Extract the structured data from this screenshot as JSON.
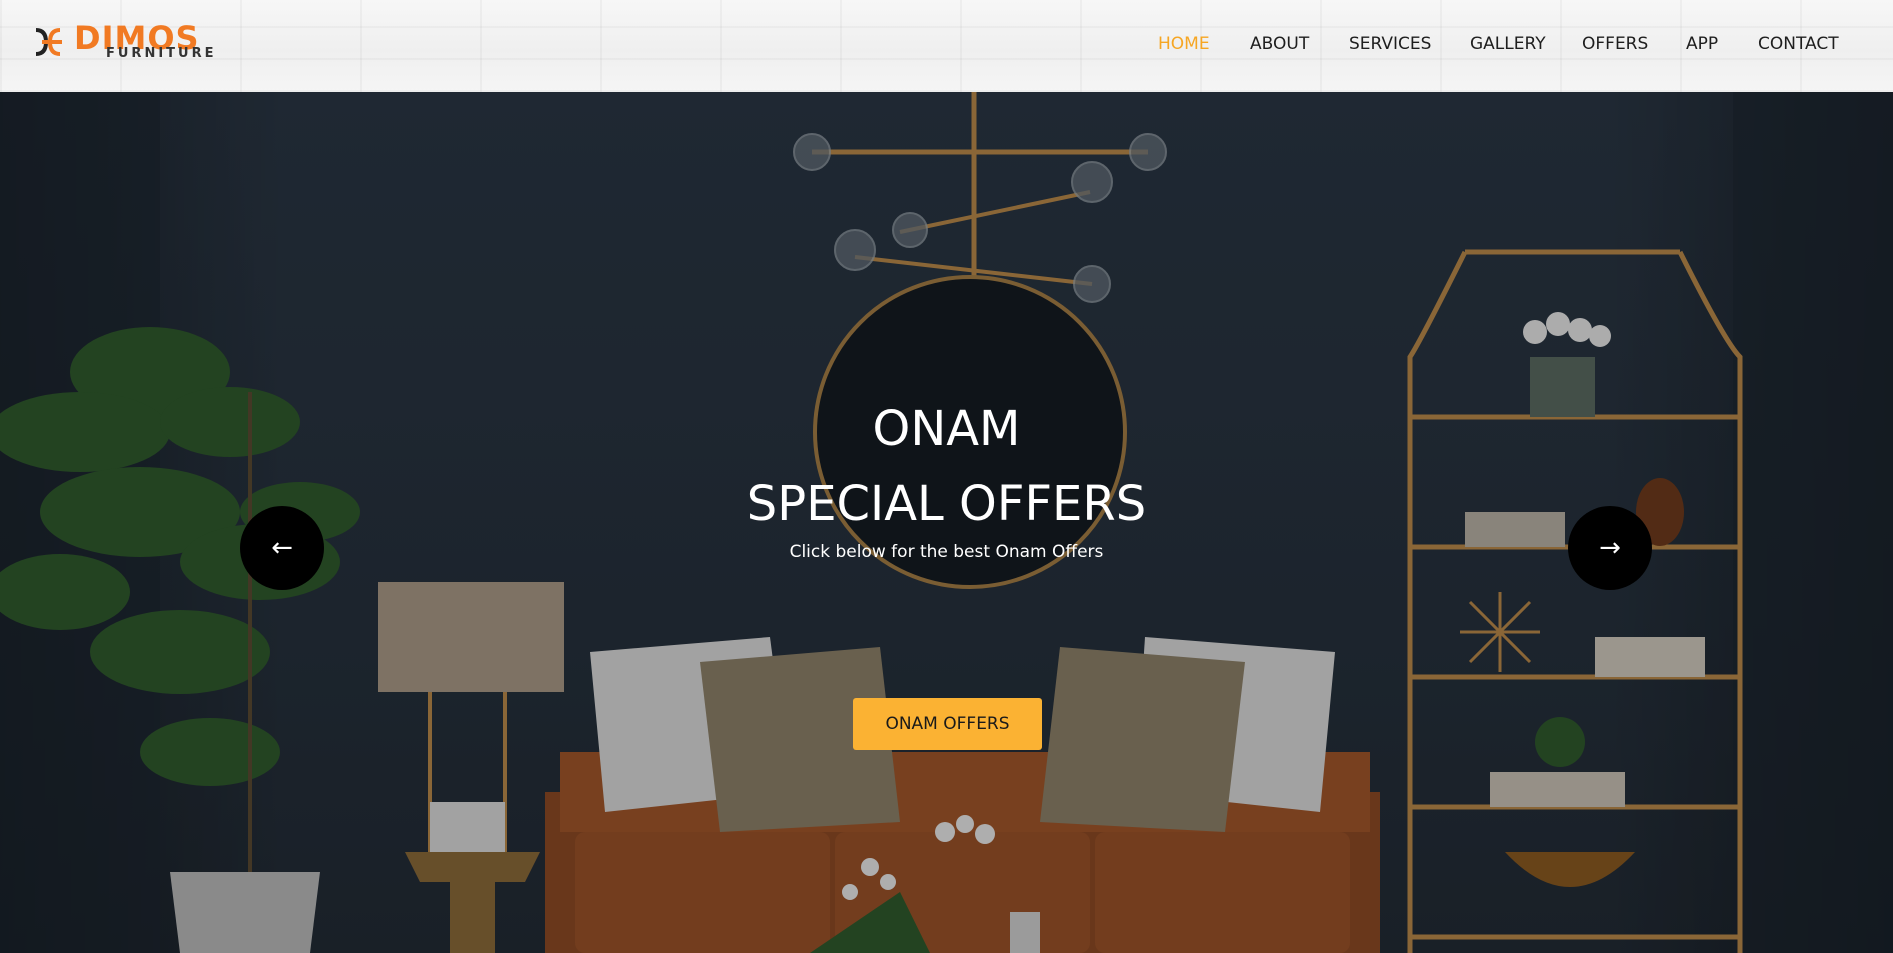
{
  "header": {
    "logo": {
      "brand": "DIMOS",
      "tagline": "FURNITURE"
    },
    "nav": [
      {
        "label": "HOME",
        "active": true
      },
      {
        "label": "ABOUT",
        "active": false
      },
      {
        "label": "SERVICES",
        "active": false
      },
      {
        "label": "GALLERY",
        "active": false
      },
      {
        "label": "OFFERS",
        "active": false
      },
      {
        "label": "APP",
        "active": false
      },
      {
        "label": "CONTACT",
        "active": false
      }
    ]
  },
  "hero": {
    "title_line1": "ONAM",
    "title_line2": "SPECIAL OFFERS",
    "subtitle": "Click below for the best Onam Offers",
    "cta_label": "ONAM OFFERS",
    "prev_icon": "←",
    "next_icon": "→"
  },
  "colors": {
    "accent": "#f6a623",
    "cta": "#fbb233",
    "brand_orange": "#f17a23"
  }
}
